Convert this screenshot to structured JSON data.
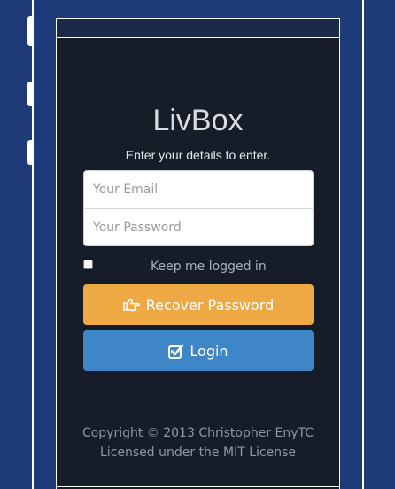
{
  "app": {
    "title": "LivBox",
    "subtitle": "Enter your details to enter."
  },
  "form": {
    "email_placeholder": "Your Email",
    "password_placeholder": "Your Password",
    "email_value": "",
    "password_value": "",
    "remember_label": "Keep me logged in",
    "remember_checked": false
  },
  "buttons": {
    "recover_label": "Recover Password",
    "recover_icon": "hand-pointer-icon",
    "login_label": "Login",
    "login_icon": "check-square-icon"
  },
  "footer": {
    "copyright": "Copyright © 2013 Christopher EnyTC",
    "license": "Licensed under the MIT License"
  },
  "colors": {
    "background": "#1e3a78",
    "screen": "#161d29",
    "recover_button": "#efa944",
    "login_button": "#3f86c8"
  }
}
